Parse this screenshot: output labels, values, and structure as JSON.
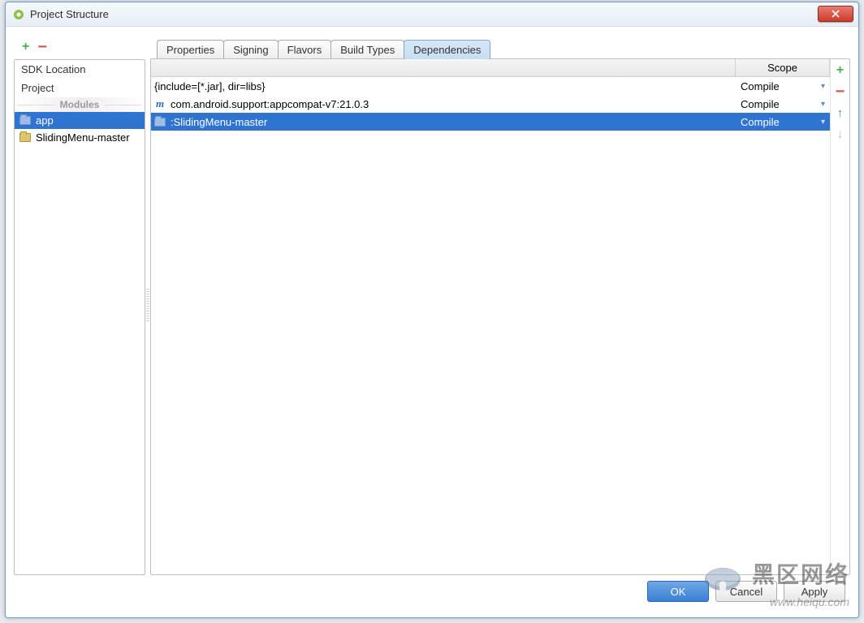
{
  "window": {
    "title": "Project Structure"
  },
  "sidebar": {
    "items": [
      {
        "label": "SDK Location"
      },
      {
        "label": "Project"
      }
    ],
    "modules_header": "Modules",
    "modules": [
      {
        "label": "app",
        "selected": true
      },
      {
        "label": "SlidingMenu-master",
        "selected": false
      }
    ]
  },
  "tabs": [
    {
      "label": "Properties"
    },
    {
      "label": "Signing"
    },
    {
      "label": "Flavors"
    },
    {
      "label": "Build Types"
    },
    {
      "label": "Dependencies",
      "active": true
    }
  ],
  "dependencies": {
    "header": {
      "scope": "Scope"
    },
    "rows": [
      {
        "name": "{include=[*.jar], dir=libs}",
        "scope": "Compile",
        "icon": "none",
        "selected": false
      },
      {
        "name": "com.android.support:appcompat-v7:21.0.3",
        "scope": "Compile",
        "icon": "m",
        "selected": false
      },
      {
        "name": ":SlidingMenu-master",
        "scope": "Compile",
        "icon": "folder",
        "selected": true
      }
    ]
  },
  "footer": {
    "ok": "OK",
    "cancel": "Cancel",
    "apply": "Apply"
  },
  "watermark": {
    "line1": "黑区网络",
    "line2": "www.heiqu.com"
  }
}
